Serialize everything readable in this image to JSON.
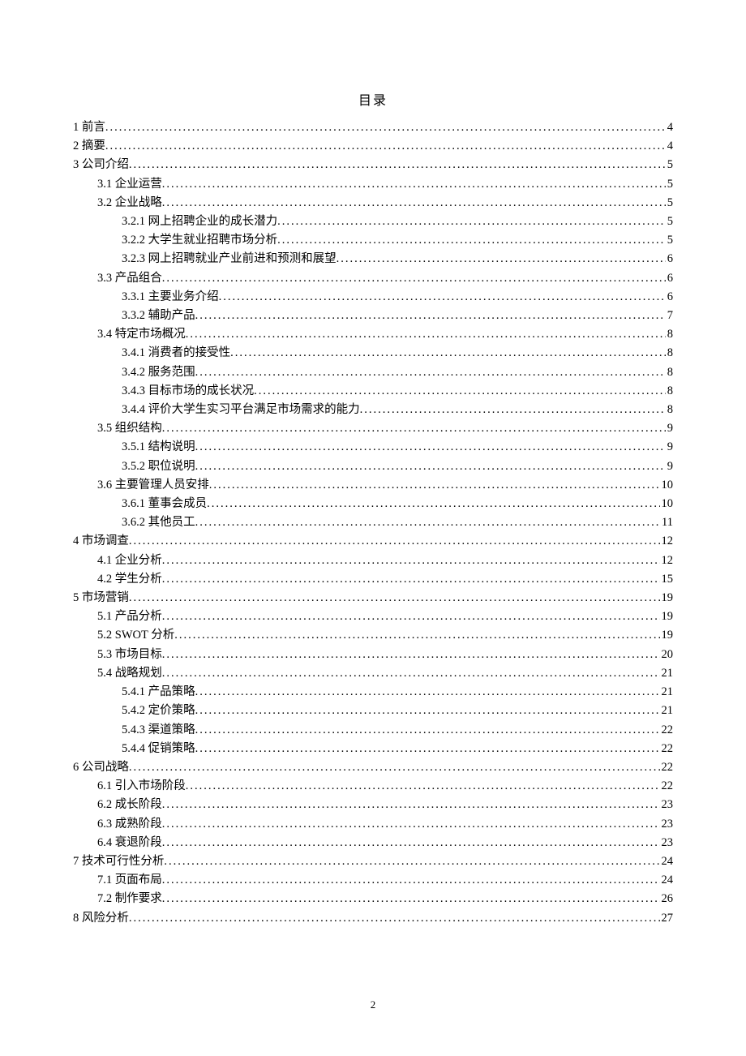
{
  "title": "目录",
  "page_number": "2",
  "toc": [
    {
      "level": 1,
      "label": "1 前言",
      "page": "4"
    },
    {
      "level": 1,
      "label": "2 摘要",
      "page": "4"
    },
    {
      "level": 1,
      "label": "3 公司介绍",
      "page": "5"
    },
    {
      "level": 2,
      "label": "3.1 企业运营",
      "page": "5"
    },
    {
      "level": 2,
      "label": "3.2 企业战略",
      "page": "5"
    },
    {
      "level": 3,
      "label": "3.2.1 网上招聘企业的成长潜力",
      "page": "5"
    },
    {
      "level": 3,
      "label": "3.2.2 大学生就业招聘市场分析",
      "page": "5"
    },
    {
      "level": 3,
      "label": "3.2.3 网上招聘就业产业前进和预测和展望",
      "page": "6"
    },
    {
      "level": 2,
      "label": "3.3 产品组合",
      "page": "6"
    },
    {
      "level": 3,
      "label": "3.3.1 主要业务介绍",
      "page": "6"
    },
    {
      "level": 3,
      "label": "3.3.2 辅助产品",
      "page": "7"
    },
    {
      "level": 2,
      "label": "3.4 特定市场概况",
      "page": "8"
    },
    {
      "level": 3,
      "label": "3.4.1 消费者的接受性",
      "page": "8"
    },
    {
      "level": 3,
      "label": "3.4.2 服务范围",
      "page": "8"
    },
    {
      "level": 3,
      "label": "3.4.3 目标市场的成长状况",
      "page": "8"
    },
    {
      "level": 3,
      "label": "3.4.4 评价大学生实习平台满足市场需求的能力",
      "page": "8"
    },
    {
      "level": 2,
      "label": "3.5 组织结构",
      "page": "9"
    },
    {
      "level": 3,
      "label": "3.5.1 结构说明",
      "page": "9"
    },
    {
      "level": 3,
      "label": "3.5.2 职位说明",
      "page": "9"
    },
    {
      "level": 2,
      "label": "3.6 主要管理人员安排",
      "page": "10"
    },
    {
      "level": 3,
      "label": "3.6.1 董事会成员",
      "page": "10"
    },
    {
      "level": 3,
      "label": "3.6.2 其他员工",
      "page": "11"
    },
    {
      "level": 1,
      "label": "4 市场调查",
      "page": "12"
    },
    {
      "level": 2,
      "label": "4.1 企业分析",
      "page": "12"
    },
    {
      "level": 2,
      "label": "4.2 学生分析",
      "page": "15"
    },
    {
      "level": 1,
      "label": "5 市场营销",
      "page": "19"
    },
    {
      "level": 2,
      "label": "5.1 产品分析",
      "page": "19"
    },
    {
      "level": 2,
      "label": "5.2 SWOT 分析",
      "page": "19"
    },
    {
      "level": 2,
      "label": "5.3 市场目标",
      "page": "20"
    },
    {
      "level": 2,
      "label": "5.4 战略规划",
      "page": "21"
    },
    {
      "level": 3,
      "label": "5.4.1 产品策略",
      "page": "21"
    },
    {
      "level": 3,
      "label": "5.4.2 定价策略",
      "page": "21"
    },
    {
      "level": 3,
      "label": "5.4.3 渠道策略",
      "page": "22"
    },
    {
      "level": 3,
      "label": "5.4.4 促销策略",
      "page": "22"
    },
    {
      "level": 1,
      "label": "6 公司战略",
      "page": "22"
    },
    {
      "level": 2,
      "label": "6.1 引入市场阶段",
      "page": "22"
    },
    {
      "level": 2,
      "label": "6.2 成长阶段",
      "page": "23"
    },
    {
      "level": 2,
      "label": "6.3 成熟阶段",
      "page": "23"
    },
    {
      "level": 2,
      "label": "6.4 衰退阶段",
      "page": "23"
    },
    {
      "level": 1,
      "label": "7 技术可行性分析",
      "page": "24"
    },
    {
      "level": 2,
      "label": "7.1 页面布局",
      "page": "24"
    },
    {
      "level": 2,
      "label": "7.2 制作要求",
      "page": "26"
    },
    {
      "level": 1,
      "label": "8 风险分析",
      "page": "27"
    }
  ]
}
